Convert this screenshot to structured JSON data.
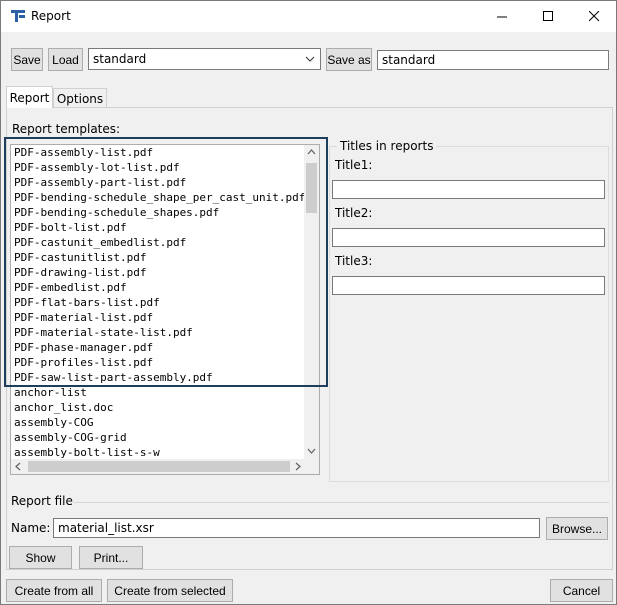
{
  "window": {
    "title": "Report"
  },
  "toolbar": {
    "save_label": "Save",
    "load_label": "Load",
    "template_select_value": "standard",
    "save_as_label": "Save as",
    "save_as_value": "standard"
  },
  "tabs": [
    {
      "label": "Report"
    },
    {
      "label": "Options"
    }
  ],
  "templates": {
    "label": "Report templates:",
    "items": [
      "PDF-assembly-list.pdf",
      "PDF-assembly-lot-list.pdf",
      "PDF-assembly-part-list.pdf",
      "PDF-bending-schedule_shape_per_cast_unit.pdf",
      "PDF-bending-schedule_shapes.pdf",
      "PDF-bolt-list.pdf",
      "PDF-castunit_embedlist.pdf",
      "PDF-castunitlist.pdf",
      "PDF-drawing-list.pdf",
      "PDF-embedlist.pdf",
      "PDF-flat-bars-list.pdf",
      "PDF-material-list.pdf",
      "PDF-material-state-list.pdf",
      "PDF-phase-manager.pdf",
      "PDF-profiles-list.pdf",
      "PDF-saw-list-part-assembly.pdf",
      "anchor-list",
      "anchor_list.doc",
      "assembly-COG",
      "assembly-COG-grid",
      "assembly-bolt-list-s-w"
    ]
  },
  "titles": {
    "group_label": "Titles in reports",
    "title1_label": "Title1:",
    "title2_label": "Title2:",
    "title3_label": "Title3:",
    "title1_value": "",
    "title2_value": "",
    "title3_value": ""
  },
  "report_file": {
    "section_label": "Report file",
    "name_label": "Name:",
    "name_value": "material_list.xsr",
    "browse_label": "Browse...",
    "show_label": "Show",
    "print_label": "Print..."
  },
  "footer": {
    "create_all_label": "Create from all",
    "create_selected_label": "Create from selected",
    "cancel_label": "Cancel"
  },
  "colors": {
    "highlight_border": "#1f3d5c",
    "app_icon": "#2b5fa8"
  }
}
